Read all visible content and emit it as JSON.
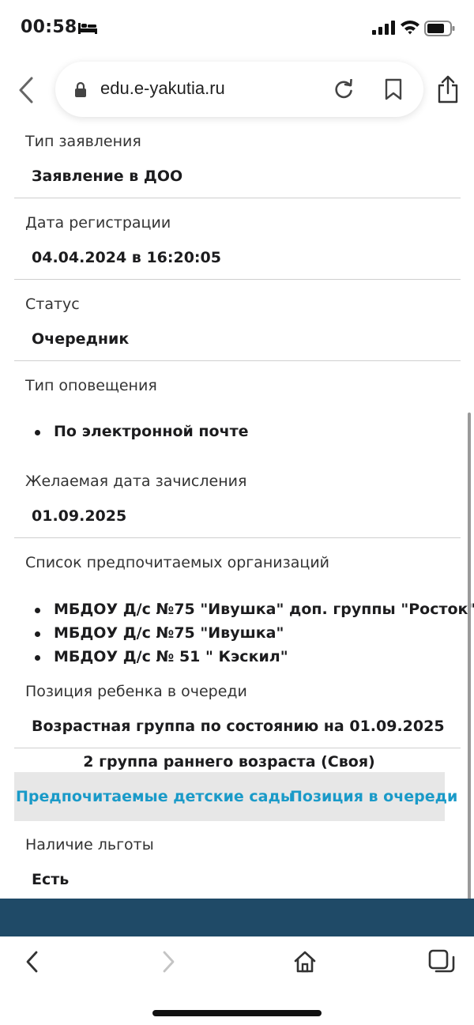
{
  "status_bar": {
    "time": "00:58"
  },
  "browser": {
    "url": "edu.e-yakutia.ru"
  },
  "sections": {
    "app_type": {
      "label": "Тип заявления",
      "value": "Заявление в ДОО"
    },
    "reg_date": {
      "label": "Дата регистрации",
      "value": "04.04.2024 в 16:20:05"
    },
    "status": {
      "label": "Статус",
      "value": "Очередник"
    },
    "notify": {
      "label": "Тип оповещения",
      "items": [
        "По электронной почте"
      ]
    },
    "desired_date": {
      "label": "Желаемая дата зачисления",
      "value": "01.09.2025"
    },
    "orgs": {
      "label": "Список предпочитаемых организаций",
      "items": [
        "МБДОУ Д/с №75 \"Ивушка\" доп. группы \"Росток\"",
        "МБДОУ Д/с №75 \"Ивушка\"",
        "МБДОУ Д/с № 51 \" Кэскил\""
      ]
    },
    "queue": {
      "label": "Позиция ребенка в очереди",
      "value": "Возрастная группа по состоянию на 01.09.2025",
      "group": "2 группа раннего возраста (Своя)"
    },
    "tabs": [
      "Предпочитаемые детские сады",
      "Позиция в очереди"
    ],
    "benefit": {
      "label": "Наличие льготы",
      "value": "Есть"
    }
  },
  "colors": {
    "link": "#1a9ac8",
    "footer": "#1f4a67",
    "tab_bg": "#e7e7e7"
  },
  "icons": [
    "bed-icon",
    "signal-icon",
    "wifi-icon",
    "battery-icon",
    "back-arrow-icon",
    "lock-icon",
    "reload-icon",
    "bookmark-icon",
    "share-icon",
    "nav-back-icon",
    "nav-forward-icon",
    "home-icon",
    "tabs-icon"
  ]
}
